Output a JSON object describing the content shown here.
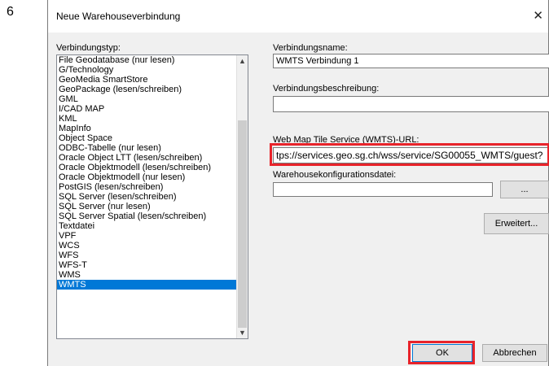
{
  "step_number": "6",
  "dialog": {
    "title": "Neue Warehouseverbindung",
    "close_glyph": "✕",
    "connection_type_label": "Verbindungstyp:",
    "connection_types": [
      "File Geodatabase (nur lesen)",
      "G/Technology",
      "GeoMedia SmartStore",
      "GeoPackage (lesen/schreiben)",
      "GML",
      "I/CAD MAP",
      "KML",
      "MapInfo",
      "Object Space",
      "ODBC-Tabelle (nur lesen)",
      "Oracle Object LTT (lesen/schreiben)",
      "Oracle Objektmodell (lesen/schreiben)",
      "Oracle Objektmodell (nur lesen)",
      "PostGIS (lesen/schreiben)",
      "SQL Server (lesen/schreiben)",
      "SQL Server (nur lesen)",
      "SQL Server Spatial (lesen/schreiben)",
      "Textdatei",
      "VPF",
      "WCS",
      "WFS",
      "WFS-T",
      "WMS",
      "WMTS"
    ],
    "selected_type": "WMTS",
    "connection_name_label": "Verbindungsname:",
    "connection_name_value": "WMTS Verbindung 1",
    "connection_description_label": "Verbindungsbeschreibung:",
    "connection_description_value": "",
    "url_label": "Web Map Tile Service (WMTS)-URL:",
    "url_value": "tps://services.geo.sg.ch/wss/service/SG00055_WMTS/guest?",
    "config_file_label": "Warehousekonfigurationsdatei:",
    "config_file_value": "",
    "browse_label": "...",
    "advanced_label": "Erweitert...",
    "ok_label": "OK",
    "cancel_label": "Abbrechen",
    "highlight_color": "#e8232a",
    "selection_color": "#0078d7"
  }
}
